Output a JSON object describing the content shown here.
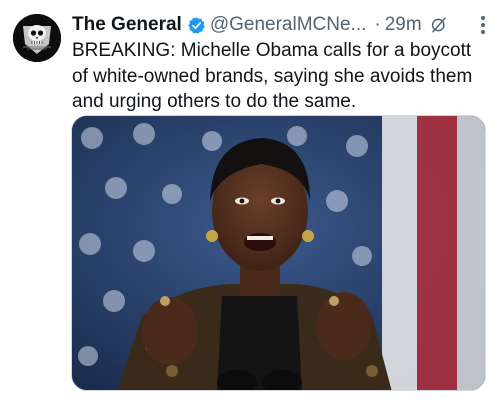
{
  "tweet": {
    "author_name": "The General",
    "handle": "@GeneralMCNe...",
    "separator": "·",
    "time": "29m",
    "text": "BREAKING: Michelle Obama calls for a boycott of white-owned brands, saying she avoids them and urging others to do the same.",
    "icons": {
      "verified": "verified-badge-icon",
      "grok": "grok-icon",
      "more": "more-options-icon"
    }
  },
  "colors": {
    "text": "#0f1419",
    "secondary": "#536471",
    "verified": "#1d9bf0"
  }
}
